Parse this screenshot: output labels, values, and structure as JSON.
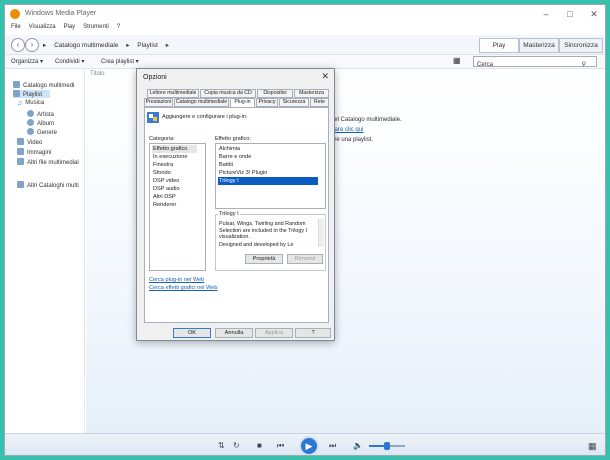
{
  "window": {
    "title": "Windows Media Player",
    "minimize_icon": "minimize-icon",
    "maximize_icon": "maximize-icon",
    "close_icon": "close-icon"
  },
  "menubar": {
    "items": [
      "File",
      "Visualizza",
      "Play",
      "Strumenti",
      "?"
    ]
  },
  "navbar": {
    "back_icon": "back-arrow-icon",
    "forward_icon": "forward-arrow-icon",
    "breadcrumb": [
      "Catalogo multimediale",
      "Playlist"
    ],
    "tabs": [
      "Play",
      "Masterizza",
      "Sincronizza"
    ]
  },
  "toolbar": {
    "organize": "Organizza",
    "share": "Condividi",
    "create_playlist": "Crea playlist",
    "search_placeholder": "Cerca"
  },
  "sidebar": {
    "items": [
      {
        "label": "Catalogo multimedi",
        "icon": "library-icon"
      },
      {
        "label": "Playlist",
        "icon": "playlist-icon",
        "selected": true
      },
      {
        "label": "Musica",
        "icon": "music-note-icon"
      },
      {
        "label": "Artista",
        "icon": "artist-icon"
      },
      {
        "label": "Album",
        "icon": "album-icon"
      },
      {
        "label": "Genere",
        "icon": "genre-icon"
      },
      {
        "label": "Video",
        "icon": "video-icon"
      },
      {
        "label": "Immagini",
        "icon": "pictures-icon"
      },
      {
        "label": "Altri file multimedial",
        "icon": "other-media-icon"
      },
      {
        "label": "Altri Cataloghi multi",
        "icon": "other-libraries-icon"
      }
    ]
  },
  "content": {
    "column_header": "Titolo",
    "hint_line1": "nel Catalogo multimediale.",
    "hint_link": "Fare clic qui",
    "hint_line3": "are una playlist."
  },
  "dialog": {
    "title": "Opzioni",
    "tabs_row1": [
      "Lettore multimediale",
      "Copia musica da CD",
      "Dispositivi",
      "Masterizza"
    ],
    "tabs_row2": [
      "Prestazioni",
      "Catalogo multimediale",
      "Plug-in",
      "Privacy",
      "Sicurezza",
      "Rete"
    ],
    "active_tab": "Plug-in",
    "intro": "Aggiungere e configurare i plug-in.",
    "category_label": "Categoria:",
    "categories": [
      "Effetto grafico",
      "In esecuzione",
      "Finestra",
      "Sfondo",
      "DSP video",
      "DSP audio",
      "Altri DSP",
      "Renderer"
    ],
    "selected_category": "Effetto grafico",
    "effects_label": "Effetto grafico:",
    "effects": [
      "Alchimia",
      "Barre e onde",
      "Battiti",
      "PictureViz 3! Plugin",
      "Trilogy I"
    ],
    "selected_effect": "Trilogy I",
    "description_title": "Trilogy I",
    "description_text": "Pulsar, Wings, Twirling and Random Selection are included in the Trilogy I visualization.",
    "description_more": "Designed and developed by Le",
    "properties_button": "Proprietà",
    "remove_button": "Rimuovi",
    "link_plugins": "Cerca plug-in nel Web",
    "link_effects": "Cerca effetti grafici nel Web",
    "ok_button": "OK",
    "cancel_button": "Annulla",
    "apply_button": "Applica",
    "help_button": "?"
  },
  "player": {
    "shuffle_icon": "shuffle-icon",
    "repeat_icon": "repeat-icon",
    "stop_icon": "stop-icon",
    "previous_icon": "previous-icon",
    "play_icon": "play-icon",
    "next_icon": "next-icon",
    "volume_icon": "speaker-icon",
    "volume_level": 0.5,
    "switch_view_icon": "switch-to-now-playing-icon"
  },
  "colors": {
    "accent": "#0a5cc2",
    "background": "#36c0ae",
    "link": "#1a5fb4"
  }
}
